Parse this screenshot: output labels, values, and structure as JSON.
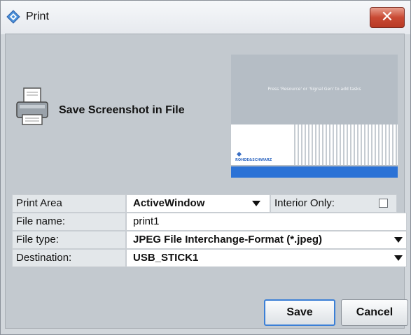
{
  "window": {
    "title": "Print",
    "close_icon": "close-icon"
  },
  "header": {
    "heading": "Save Screenshot in File"
  },
  "preview": {
    "hint": "Press 'Resource' or 'Signal Gen' to add tasks",
    "logo": "ROHDE&SCHWARZ"
  },
  "form": {
    "print_area": {
      "label": "Print Area",
      "value": "ActiveWindow"
    },
    "interior_only": {
      "label": "Interior Only:",
      "checked": false
    },
    "file_name": {
      "label": "File name:",
      "value": "print1"
    },
    "file_type": {
      "label": "File type:",
      "value": "JPEG File Interchange-Format (*.jpeg)"
    },
    "destination": {
      "label": "Destination:",
      "value": "USB_STICK1"
    }
  },
  "buttons": {
    "save": "Save",
    "cancel": "Cancel"
  },
  "colors": {
    "close": "#c94a34",
    "focus": "#3b7fd6",
    "preview_bar": "#2b72d6"
  }
}
